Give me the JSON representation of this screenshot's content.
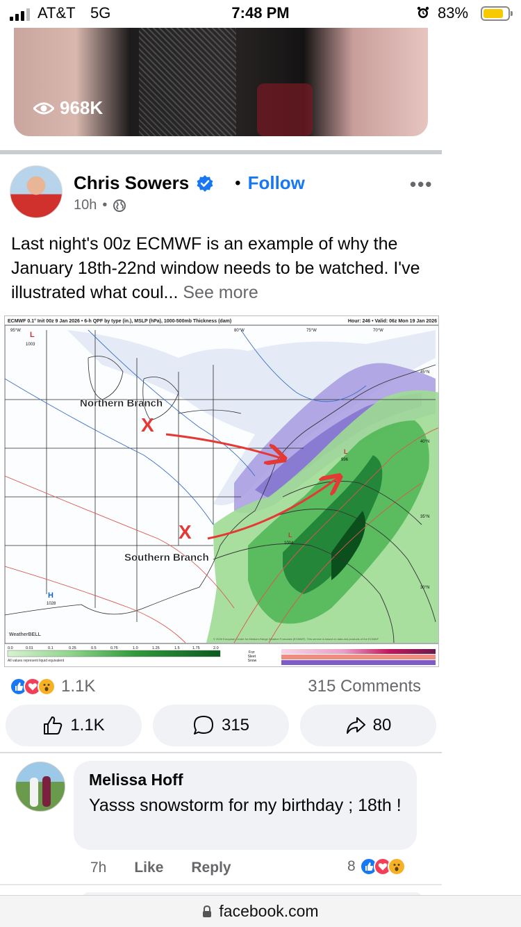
{
  "status_bar": {
    "carrier": "AT&T",
    "network": "5G",
    "time": "7:48 PM",
    "battery_pct": "83%",
    "battery_level": 0.83
  },
  "reel": {
    "views": "968K"
  },
  "post": {
    "author": "Chris Sowers",
    "follow_label": "Follow",
    "time": "10h",
    "text": "Last night's 00z ECMWF is an example of why the January 18th-22nd window needs to be watched. I've illustrated what coul...",
    "see_more": "See more",
    "map": {
      "header_left": "ECMWF 0.1° Init 00z 9 Jan 2026 • 6-h QPF by type (in.), MSLP (hPa), 1000-500mb Thickness (dam)",
      "header_right": "Hour: 246 • Valid: 06z Mon 19 Jan 2026",
      "label_north": "Northern Branch",
      "label_south": "Southern Branch",
      "lon_labels": [
        "95°W",
        "80°W",
        "75°W",
        "70°W"
      ],
      "lat_labels": [
        "45°N",
        "40°N",
        "35°N",
        "30°N"
      ],
      "pressures": [
        "1003",
        "1028",
        "1004",
        "996"
      ],
      "legend_rain_ticks": [
        "0.0",
        "0.01",
        "0.1",
        "0.25",
        "0.5",
        "0.75",
        "1.0",
        "1.25",
        "1.5",
        "1.75",
        "2.0"
      ],
      "legend_note": "All values represent liquid equivalent",
      "legend_mix_labels": [
        "Frzr",
        "Sleet",
        "Snow"
      ],
      "copyright": "© 2026 European Centre for Medium-Range Weather Forecasts (ECMWF). This service is based on data and products of the ECMWF",
      "brand": "WeatherBELL"
    },
    "reactions_count": "1.1K",
    "comments_count": "315 Comments",
    "actions": {
      "like": "1.1K",
      "comment": "315",
      "share": "80"
    }
  },
  "comment": {
    "author": "Melissa Hoff",
    "text": "Yasss snowstorm for my birthday ; 18th !",
    "time": "7h",
    "like_label": "Like",
    "reply_label": "Reply",
    "reactions": "8"
  },
  "url_bar": {
    "domain": "facebook.com"
  }
}
